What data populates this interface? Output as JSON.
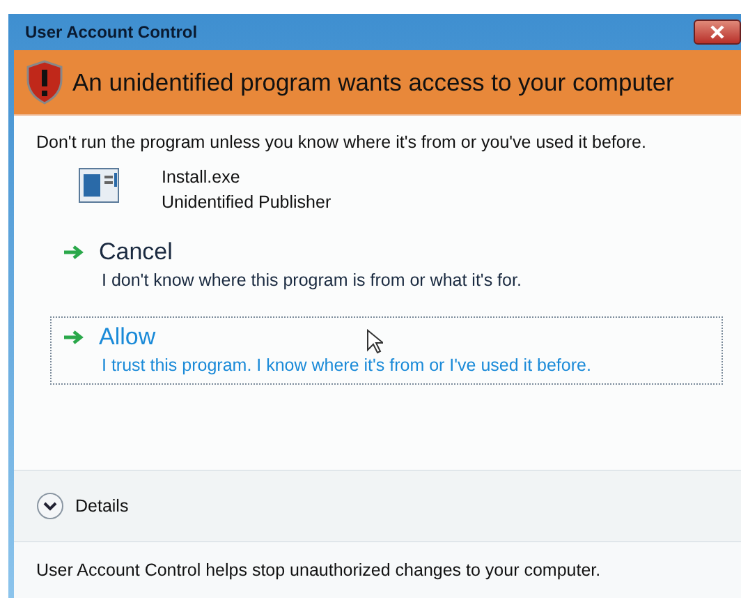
{
  "window": {
    "title": "User Account Control"
  },
  "banner": {
    "title": "An unidentified program wants access to your computer"
  },
  "warning": "Don't run the program unless you know where it's from or you've used it before.",
  "program": {
    "name": "Install.exe",
    "publisher": "Unidentified Publisher"
  },
  "options": [
    {
      "title": "Cancel",
      "description": "I don't know where this program is from or what it's for.",
      "selected": false
    },
    {
      "title": "Allow",
      "description": "I trust this program. I know where it's from or I've used it before.",
      "selected": true
    }
  ],
  "details": {
    "label": "Details",
    "expanded": false
  },
  "footer": "User Account Control helps stop unauthorized changes to your computer."
}
